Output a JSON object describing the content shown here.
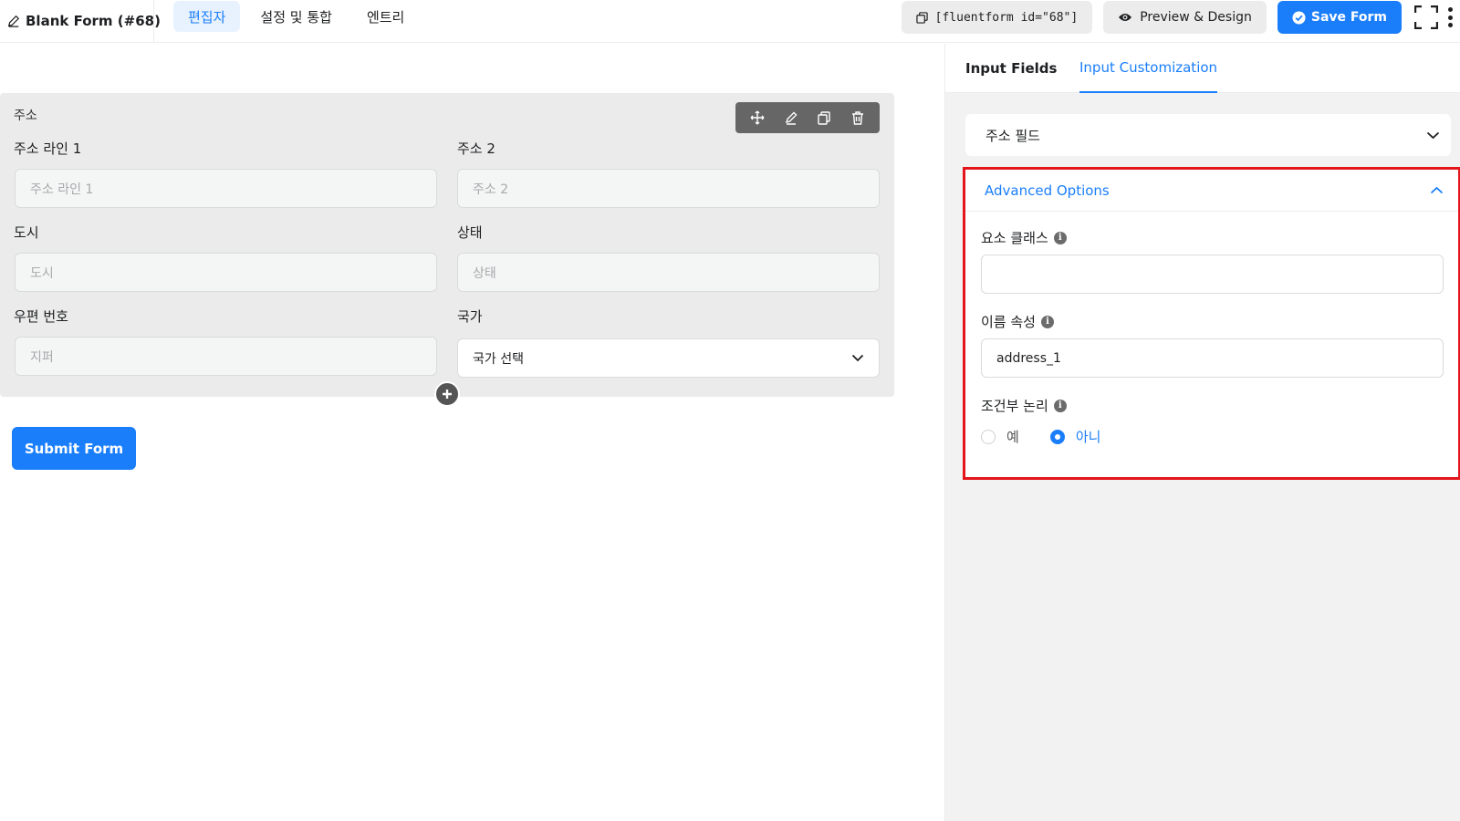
{
  "topbar": {
    "form_title": "Blank Form (#68)",
    "tabs": [
      {
        "label": "편집자",
        "active": true
      },
      {
        "label": "설정 및 통합",
        "active": false
      },
      {
        "label": "엔트리",
        "active": false
      }
    ],
    "shortcode": "[fluentform id=\"68\"]",
    "preview_label": "Preview & Design",
    "save_label": "Save Form"
  },
  "editor": {
    "field_label": "주소",
    "subfields": {
      "address1": {
        "label": "주소 라인 1",
        "placeholder": "주소 라인 1"
      },
      "address2": {
        "label": "주소 2",
        "placeholder": "주소 2"
      },
      "city": {
        "label": "도시",
        "placeholder": "도시"
      },
      "state": {
        "label": "상태",
        "placeholder": "상태"
      },
      "zip": {
        "label": "우편 번호",
        "placeholder": "지퍼"
      },
      "country": {
        "label": "국가",
        "value": "국가 선택"
      }
    },
    "submit_label": "Submit Form"
  },
  "panel": {
    "tabs": [
      {
        "label": "Input Fields",
        "active": false
      },
      {
        "label": "Input Customization",
        "active": true
      }
    ],
    "section_title": "주소 필드",
    "advanced": {
      "title": "Advanced Options",
      "element_class_label": "요소 클래스",
      "element_class_value": "",
      "name_attr_label": "이름 속성",
      "name_attr_value": "address_1",
      "conditional_label": "조건부 논리",
      "radio_yes": "예",
      "radio_no": "아니",
      "selected": "no"
    }
  },
  "colors": {
    "primary": "#1a7efb",
    "highlight_border": "#e3151b",
    "panel_bg": "#f2f2f2",
    "card_bg": "#ebebeb"
  }
}
